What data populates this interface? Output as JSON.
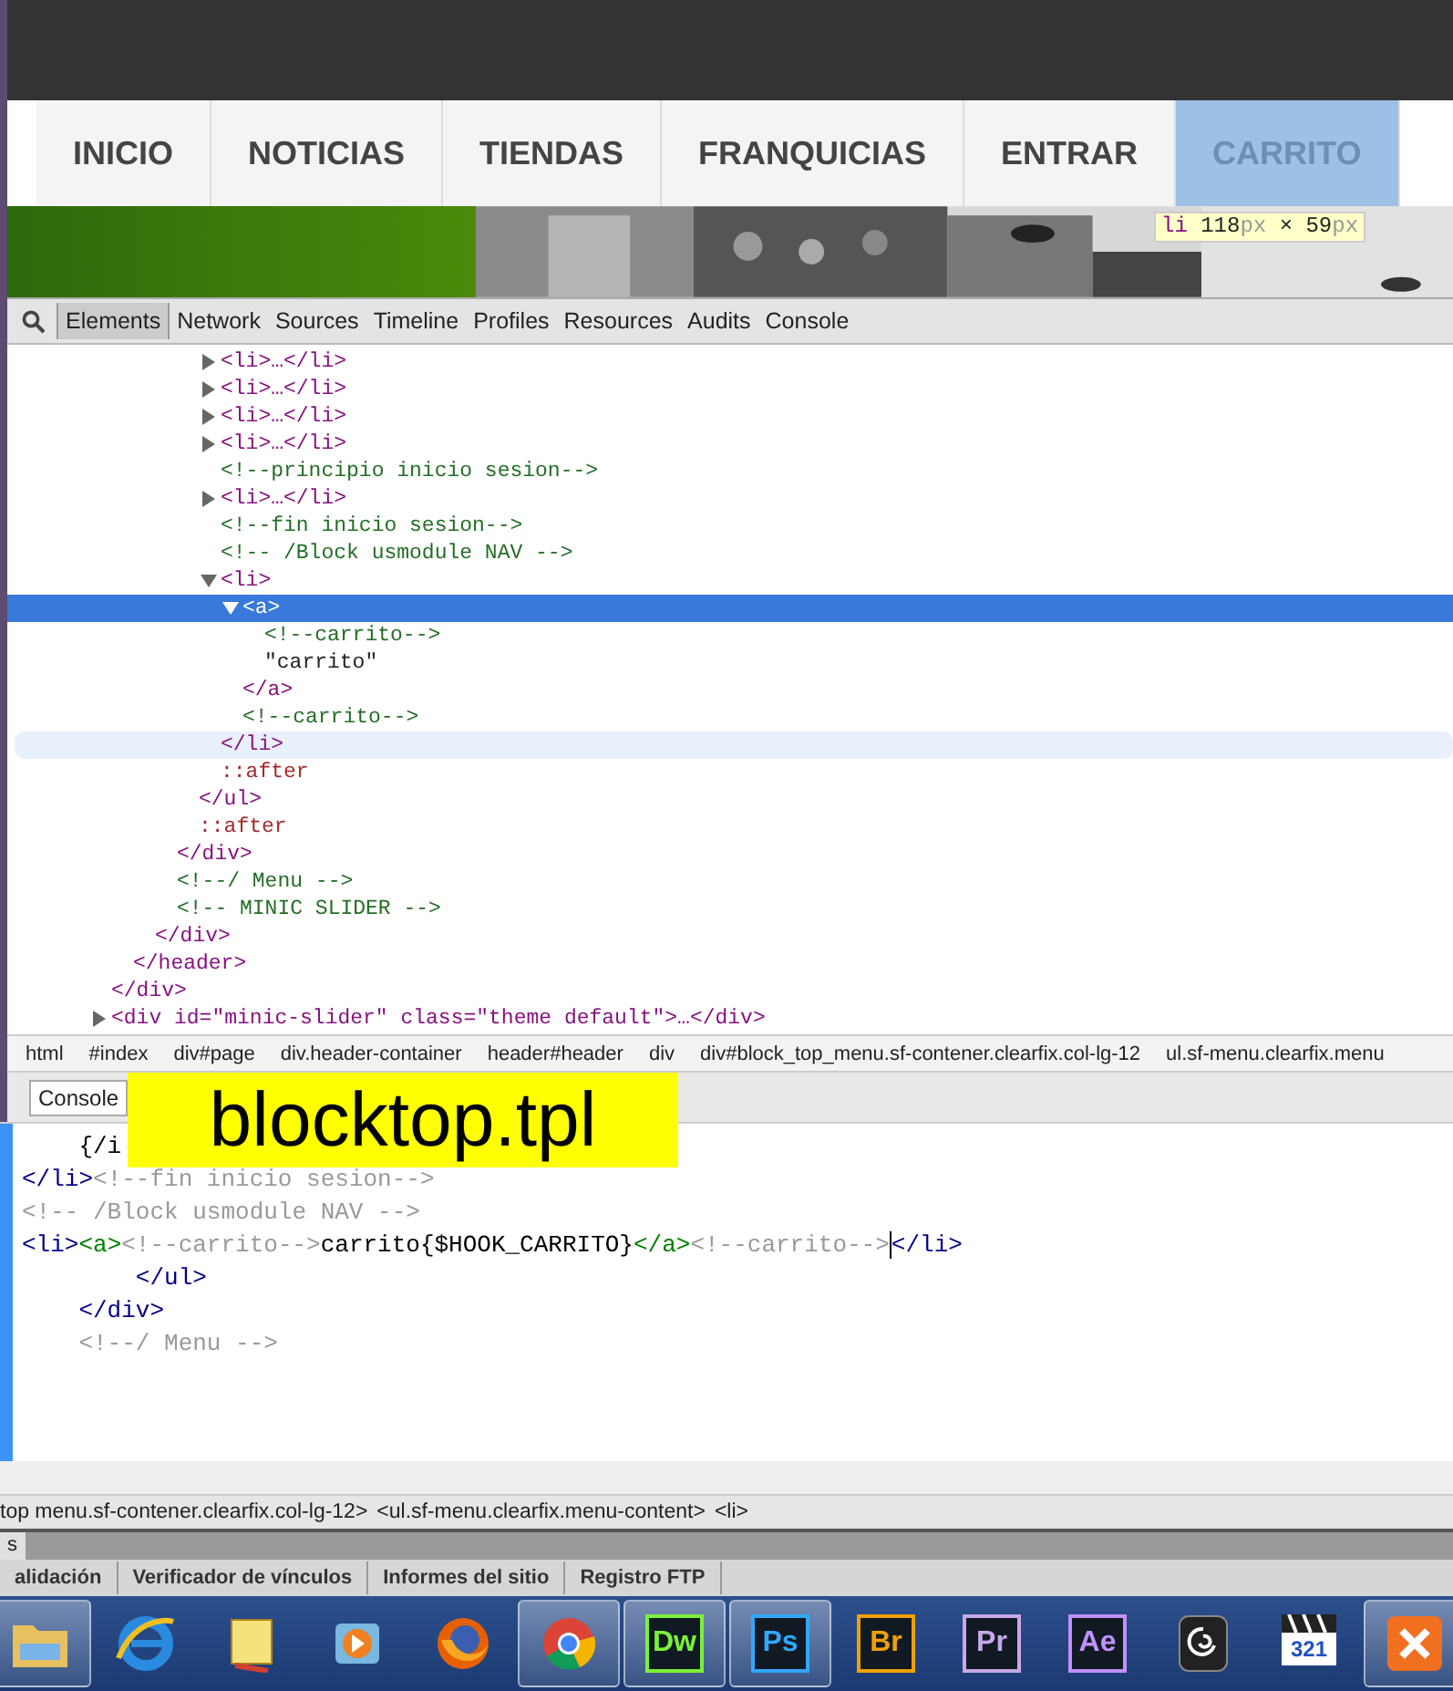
{
  "nav": {
    "items": [
      {
        "label": "INICIO",
        "selected": false
      },
      {
        "label": "NOTICIAS",
        "selected": false
      },
      {
        "label": "TIENDAS",
        "selected": false
      },
      {
        "label": "FRANQUICIAS",
        "selected": false
      },
      {
        "label": "ENTRAR",
        "selected": false
      },
      {
        "label": "CARRITO",
        "selected": true
      }
    ]
  },
  "banner": {
    "kind": "picture"
  },
  "tooltip": {
    "parts": [
      {
        "kind": "tag",
        "text": "li"
      },
      {
        "kind": "num",
        "text": " 118"
      },
      {
        "kind": "unit",
        "text": "px"
      },
      {
        "kind": "sep",
        "text": " × "
      },
      {
        "kind": "num",
        "text": "59"
      },
      {
        "kind": "unit",
        "text": "px"
      }
    ]
  },
  "devtools": {
    "tabs": [
      {
        "label": "Elements",
        "selected": true
      },
      {
        "label": "Network",
        "selected": false
      },
      {
        "label": "Sources",
        "selected": false
      },
      {
        "label": "Timeline",
        "selected": false
      },
      {
        "label": "Profiles",
        "selected": false
      },
      {
        "label": "Resources",
        "selected": false
      },
      {
        "label": "Audits",
        "selected": false
      },
      {
        "label": "Console",
        "selected": false
      }
    ],
    "tree": [
      {
        "kind": "element",
        "close": "</div>",
        "children": [
          {
            "kind": "element",
            "close": "</header>",
            "children": [
              {
                "kind": "element",
                "close": "</div>",
                "children": [
                  {
                    "kind": "element",
                    "close": "</div>",
                    "children": [
                      {
                        "kind": "element",
                        "close": "</ul>",
                        "children": [
                          {
                            "kind": "collapsed",
                            "text": "<li>…</li>"
                          },
                          {
                            "kind": "collapsed",
                            "text": "<li>…</li>"
                          },
                          {
                            "kind": "collapsed",
                            "text": "<li>…</li>"
                          },
                          {
                            "kind": "collapsed",
                            "text": "<li>…</li>"
                          },
                          {
                            "kind": "comment",
                            "text": "<!--principio inicio sesion-->"
                          },
                          {
                            "kind": "collapsed",
                            "text": "<li>…</li>"
                          },
                          {
                            "kind": "comment",
                            "text": "<!--fin inicio sesion-->"
                          },
                          {
                            "kind": "comment",
                            "text": "<!-- /Block usmodule NAV -->"
                          },
                          {
                            "kind": "element",
                            "open": "<li>",
                            "selected": false,
                            "close": "</li>",
                            "close_hovered": true,
                            "children": [
                              {
                                "kind": "element",
                                "open": "<a>",
                                "selected": true,
                                "close": "</a>",
                                "close_hovered": false,
                                "children": [
                                  {
                                    "kind": "comment",
                                    "text": "<!--carrito-->"
                                  },
                                  {
                                    "kind": "text",
                                    "text": "\"carrito\""
                                  }
                                ]
                              },
                              {
                                "kind": "comment",
                                "text": "<!--carrito-->"
                              }
                            ]
                          },
                          {
                            "kind": "pseudo",
                            "text": "::after"
                          }
                        ]
                      },
                      {
                        "kind": "pseudo",
                        "text": "::after"
                      }
                    ]
                  },
                  {
                    "kind": "comment",
                    "text": "<!--/ Menu -->"
                  },
                  {
                    "kind": "comment",
                    "text": "<!-- MINIC SLIDER -->"
                  }
                ]
              }
            ]
          }
        ]
      },
      {
        "kind": "collapsed",
        "text": "<div id=\"minic-slider\" class=\"theme default\">…</div>"
      }
    ],
    "breadcrumbs": [
      "html",
      "#index",
      "div#page",
      "div.header-container",
      "header#header",
      "div",
      "div#block_top_menu.sf-contener.clearfix.col-lg-12",
      "ul.sf-menu.clearfix.menu"
    ],
    "console_button": "Console"
  },
  "overlay_label": "blocktop.tpl",
  "editor": {
    "lines": [
      [
        {
          "kind": "text",
          "text": "    {/i"
        }
      ],
      [
        {
          "kind": "tag",
          "text": "</li>"
        },
        {
          "kind": "comment",
          "text": "<!--fin inicio sesion-->"
        }
      ],
      [
        {
          "kind": "comment",
          "text": "<!-- /Block usmodule NAV -->"
        }
      ],
      [
        {
          "kind": "tag",
          "text": "<li>"
        },
        {
          "kind": "atag",
          "text": "<a>"
        },
        {
          "kind": "comment",
          "text": "<!--carrito-->"
        },
        {
          "kind": "text",
          "text": "carrito{$HOOK_CARRITO}"
        },
        {
          "kind": "atag",
          "text": "</a>"
        },
        {
          "kind": "comment",
          "text": "<!--carrito-->"
        },
        {
          "kind": "cursor"
        },
        {
          "kind": "tag",
          "text": "</li>"
        }
      ],
      [
        {
          "kind": "tag",
          "text": "        </ul>"
        }
      ],
      [
        {
          "kind": "tag",
          "text": "    </div>"
        }
      ],
      [
        {
          "kind": "comment",
          "text": "    <!--/ Menu -->"
        }
      ]
    ]
  },
  "status_path": [
    "top menu.sf-contener.clearfix.col-lg-12>",
    "<ul.sf-menu.clearfix.menu-content>",
    "<li>"
  ],
  "panel_strip_tab": "s",
  "panel_tabs": [
    "alidación",
    "Verificador de vínculos",
    "Informes del sitio",
    "Registro FTP"
  ],
  "taskbar": [
    {
      "kind": "folder",
      "running": true
    },
    {
      "kind": "ie",
      "running": false
    },
    {
      "kind": "note",
      "running": false
    },
    {
      "kind": "player",
      "running": false
    },
    {
      "kind": "firefox",
      "running": false
    },
    {
      "kind": "chrome",
      "running": true
    },
    {
      "kind": "tile",
      "label": "Dw",
      "color": "#7cf03a",
      "running": true
    },
    {
      "kind": "tile",
      "label": "Ps",
      "color": "#31a8ff",
      "running": true
    },
    {
      "kind": "tile",
      "label": "Br",
      "color": "#f0a000",
      "running": false
    },
    {
      "kind": "tile",
      "label": "Pr",
      "color": "#c8a8e8",
      "running": false
    },
    {
      "kind": "tile",
      "label": "Ae",
      "color": "#c090ff",
      "running": false
    },
    {
      "kind": "swirl",
      "running": false
    },
    {
      "kind": "clapper",
      "label": "321",
      "running": false
    },
    {
      "kind": "xampp",
      "running": true
    }
  ]
}
